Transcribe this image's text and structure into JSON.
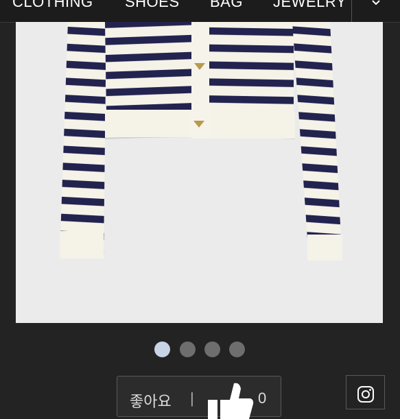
{
  "nav": {
    "items": [
      "CLOTHING",
      "SHOES",
      "BAG",
      "JEWELRY"
    ],
    "more_icon": "chevron-down-icon"
  },
  "photo": {
    "stripe_colors": {
      "ground": "#f5f2e8",
      "stripe": "#23234f"
    },
    "button_color": "#b89a4a"
  },
  "carousel": {
    "slide_count": 4,
    "active_index": 0
  },
  "like": {
    "label": "좋아요",
    "separator": "|",
    "icon": "thumbs-up-icon",
    "count": "0"
  },
  "social": {
    "icon": "instagram-icon"
  }
}
